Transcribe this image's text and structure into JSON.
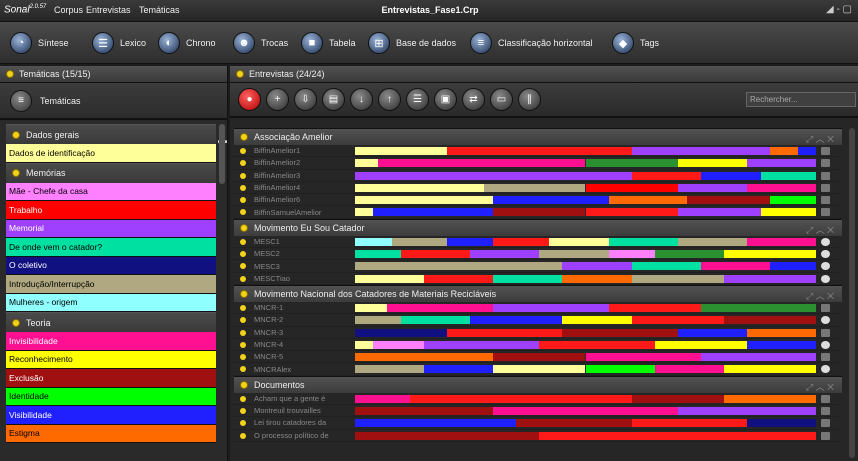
{
  "window": {
    "logo": "Sonal",
    "logo_sup": "2.0.57",
    "menu": [
      "Corpus",
      "Entrevistas",
      "Temáticas"
    ],
    "title": "Entrevistas_Fase1.Crp",
    "controls": "◢ - ▢"
  },
  "toolbar": [
    {
      "label": "Síntese",
      "icon": "synthesis-icon",
      "glyph": "◔"
    },
    {
      "label": "Lexico",
      "icon": "lexicon-icon",
      "glyph": "☰"
    },
    {
      "label": "Chrono",
      "icon": "chrono-icon",
      "glyph": "◐"
    },
    {
      "label": "Trocas",
      "icon": "exchanges-icon",
      "glyph": "☻"
    },
    {
      "label": "Tabela",
      "icon": "table-icon",
      "glyph": "■"
    },
    {
      "label": "Base de dados",
      "icon": "database-icon",
      "glyph": "⊞"
    },
    {
      "label": "Classificação horizontal",
      "icon": "classification-icon",
      "glyph": "≡"
    },
    {
      "label": "Tags",
      "icon": "tags-icon",
      "glyph": "◆"
    }
  ],
  "left_panel": {
    "header": "Temáticas (15/15)",
    "header_ctl": "▬",
    "sub_label": "Temáticas",
    "groups": [
      {
        "name": "Dados gerais",
        "themes": [
          {
            "label": "Dados de identificação",
            "color": "#ffff99",
            "text": "#000000"
          }
        ]
      },
      {
        "name": "Memórias",
        "themes": [
          {
            "label": "Mãe - Chefe da casa",
            "color": "#ff80ff",
            "text": "#000000"
          },
          {
            "label": "Trabalho",
            "color": "#ff0000",
            "text": "#ffffff"
          },
          {
            "label": "Memorial",
            "color": "#a040ff",
            "text": "#ffffff"
          },
          {
            "label": "De onde vem o catador?",
            "color": "#00e0a0",
            "text": "#000000"
          },
          {
            "label": "O coletivo",
            "color": "#101080",
            "text": "#ffffff"
          },
          {
            "label": "Introdução/Interrupção",
            "color": "#b0a880",
            "text": "#000000"
          },
          {
            "label": "Mulheres - origem",
            "color": "#90ffff",
            "text": "#000000"
          }
        ]
      },
      {
        "name": "Teoria",
        "themes": [
          {
            "label": "Invisibilidade",
            "color": "#ff1090",
            "text": "#ffffff"
          },
          {
            "label": "Reconhecimento",
            "color": "#ffff00",
            "text": "#000000"
          },
          {
            "label": "Exclusão",
            "color": "#a01010",
            "text": "#ffffff"
          },
          {
            "label": "Identidade",
            "color": "#00ff00",
            "text": "#000000"
          },
          {
            "label": "Visibilidade",
            "color": "#2020ff",
            "text": "#ffffff"
          },
          {
            "label": "Estigma",
            "color": "#ff6a00",
            "text": "#000000"
          }
        ]
      }
    ]
  },
  "right_panel": {
    "header": "Entrevistas (24/24)",
    "search_placeholder": "Rechercher...",
    "buttons": [
      {
        "icon": "record-icon",
        "glyph": "●"
      },
      {
        "icon": "add-interview-icon",
        "glyph": "+"
      },
      {
        "icon": "import-icon",
        "glyph": "⇩"
      },
      {
        "icon": "document-icon",
        "glyph": "▤"
      },
      {
        "icon": "download-icon",
        "glyph": "↓"
      },
      {
        "icon": "upload-icon",
        "glyph": "↑"
      },
      {
        "icon": "list-icon",
        "glyph": "☰"
      },
      {
        "icon": "image-icon",
        "glyph": "▣"
      },
      {
        "icon": "transfer-icon",
        "glyph": "⇄"
      },
      {
        "icon": "screen-icon",
        "glyph": "▭"
      },
      {
        "icon": "pause-icon",
        "glyph": "∥"
      }
    ],
    "groups": [
      {
        "name": "Associação Amelior",
        "icon_type": "list",
        "rows": [
          {
            "label": "BiffinAmelior1",
            "segs": [
              [
                0,
                0.2,
                "#ffff99"
              ],
              [
                0.2,
                0.6,
                "#ff1a1a"
              ],
              [
                0.6,
                0.9,
                "#a040ff"
              ],
              [
                0.9,
                0.96,
                "#ff6a00"
              ],
              [
                0.96,
                1,
                "#2020ff"
              ]
            ]
          },
          {
            "label": "BiffinAmelior2",
            "segs": [
              [
                0,
                0.05,
                "#ffff99"
              ],
              [
                0.05,
                0.5,
                "#ff1090"
              ],
              [
                0.5,
                0.7,
                "#2a9030"
              ],
              [
                0.7,
                0.85,
                "#ffff00"
              ],
              [
                0.85,
                1,
                "#a040ff"
              ]
            ]
          },
          {
            "label": "BiffinAmelior3",
            "segs": [
              [
                0,
                0.6,
                "#a040ff"
              ],
              [
                0.6,
                0.75,
                "#ff1a1a"
              ],
              [
                0.75,
                0.88,
                "#2020ff"
              ],
              [
                0.88,
                1,
                "#00e0a0"
              ]
            ]
          },
          {
            "label": "BiffinAmelior4",
            "segs": [
              [
                0,
                0.28,
                "#ffff99"
              ],
              [
                0.28,
                0.5,
                "#b0a880"
              ],
              [
                0.5,
                0.7,
                "#ff0000"
              ],
              [
                0.7,
                0.85,
                "#a040ff"
              ],
              [
                0.85,
                1,
                "#ff1090"
              ]
            ]
          },
          {
            "label": "BiffinAmelior6",
            "segs": [
              [
                0,
                0.3,
                "#ffff99"
              ],
              [
                0.3,
                0.55,
                "#2020ff"
              ],
              [
                0.55,
                0.72,
                "#ff6a00"
              ],
              [
                0.72,
                0.9,
                "#a01010"
              ],
              [
                0.9,
                1,
                "#00ff00"
              ]
            ]
          },
          {
            "label": "BiffinSamuelAmelior",
            "segs": [
              [
                0,
                0.04,
                "#ffff99"
              ],
              [
                0.04,
                0.3,
                "#2020ff"
              ],
              [
                0.3,
                0.5,
                "#a01010"
              ],
              [
                0.5,
                0.7,
                "#ff1a1a"
              ],
              [
                0.7,
                0.88,
                "#a040ff"
              ],
              [
                0.88,
                1,
                "#ffff00"
              ]
            ]
          }
        ]
      },
      {
        "name": "Movimento Eu Sou Catador",
        "icon_type": "play",
        "rows": [
          {
            "label": "MESC1",
            "segs": [
              [
                0,
                0.08,
                "#90ffff"
              ],
              [
                0.08,
                0.2,
                "#b0a880"
              ],
              [
                0.2,
                0.3,
                "#2020ff"
              ],
              [
                0.3,
                0.42,
                "#ff1a1a"
              ],
              [
                0.42,
                0.55,
                "#ffff99"
              ],
              [
                0.55,
                0.7,
                "#00e0a0"
              ],
              [
                0.7,
                0.85,
                "#b0a880"
              ],
              [
                0.85,
                1,
                "#ff1090"
              ]
            ]
          },
          {
            "label": "MESC2",
            "segs": [
              [
                0,
                0.1,
                "#00e0a0"
              ],
              [
                0.1,
                0.25,
                "#ff1a1a"
              ],
              [
                0.25,
                0.4,
                "#a040ff"
              ],
              [
                0.4,
                0.55,
                "#b0a880"
              ],
              [
                0.55,
                0.65,
                "#ff80ff"
              ],
              [
                0.65,
                0.8,
                "#2a9030"
              ],
              [
                0.8,
                1,
                "#ffff00"
              ]
            ]
          },
          {
            "label": "MESC3",
            "segs": [
              [
                0,
                0.45,
                "#b0a880"
              ],
              [
                0.45,
                0.6,
                "#a040ff"
              ],
              [
                0.6,
                0.75,
                "#00e0a0"
              ],
              [
                0.75,
                0.9,
                "#ff1090"
              ],
              [
                0.9,
                1,
                "#2020ff"
              ]
            ]
          },
          {
            "label": "MESCTiao",
            "segs": [
              [
                0,
                0.15,
                "#ffff99"
              ],
              [
                0.15,
                0.3,
                "#ff1a1a"
              ],
              [
                0.3,
                0.45,
                "#00e0a0"
              ],
              [
                0.45,
                0.6,
                "#ff6a00"
              ],
              [
                0.6,
                0.8,
                "#b0a880"
              ],
              [
                0.8,
                1,
                "#a040ff"
              ]
            ]
          }
        ]
      },
      {
        "name": "Movimento Nacional dos Catadores de Materiais Recicláveis",
        "icon_type": "mixed",
        "rows": [
          {
            "label": "MNCR-1",
            "segs": [
              [
                0,
                0.07,
                "#ffff99"
              ],
              [
                0.07,
                0.3,
                "#ff1090"
              ],
              [
                0.3,
                0.55,
                "#a040ff"
              ],
              [
                0.55,
                0.75,
                "#ff1a1a"
              ],
              [
                0.75,
                1,
                "#2a9030"
              ]
            ]
          },
          {
            "label": "MNCR-2",
            "segs": [
              [
                0,
                0.1,
                "#b0a880"
              ],
              [
                0.1,
                0.25,
                "#00e0a0"
              ],
              [
                0.25,
                0.45,
                "#2020ff"
              ],
              [
                0.45,
                0.6,
                "#ffff00"
              ],
              [
                0.6,
                0.8,
                "#ff1a1a"
              ],
              [
                0.8,
                1,
                "#a01010"
              ]
            ]
          },
          {
            "label": "MNCR-3",
            "segs": [
              [
                0,
                0.2,
                "#101080"
              ],
              [
                0.2,
                0.45,
                "#ff1a1a"
              ],
              [
                0.45,
                0.7,
                "#a01010"
              ],
              [
                0.7,
                0.85,
                "#2020ff"
              ],
              [
                0.85,
                1,
                "#ff6a00"
              ]
            ]
          },
          {
            "label": "MNCR-4",
            "segs": [
              [
                0,
                0.04,
                "#ffff99"
              ],
              [
                0.04,
                0.15,
                "#ff80ff"
              ],
              [
                0.15,
                0.4,
                "#a040ff"
              ],
              [
                0.4,
                0.65,
                "#ff1a1a"
              ],
              [
                0.65,
                0.85,
                "#ffff00"
              ],
              [
                0.85,
                1,
                "#2020ff"
              ]
            ]
          },
          {
            "label": "MNCR-5",
            "segs": [
              [
                0,
                0.3,
                "#ff6a00"
              ],
              [
                0.3,
                0.5,
                "#a01010"
              ],
              [
                0.5,
                0.75,
                "#ff1090"
              ],
              [
                0.75,
                1,
                "#a040ff"
              ]
            ]
          },
          {
            "label": "MNCRAlex",
            "segs": [
              [
                0,
                0.15,
                "#b0a880"
              ],
              [
                0.15,
                0.3,
                "#2020ff"
              ],
              [
                0.3,
                0.5,
                "#ffff99"
              ],
              [
                0.5,
                0.65,
                "#00ff00"
              ],
              [
                0.65,
                0.8,
                "#ff1090"
              ],
              [
                0.8,
                1,
                "#ffff00"
              ]
            ]
          }
        ]
      },
      {
        "name": "Documentos",
        "icon_type": "list",
        "rows": [
          {
            "label": "Acham que a gente é",
            "segs": [
              [
                0,
                0.12,
                "#ff1090"
              ],
              [
                0.12,
                0.6,
                "#ff1a1a"
              ],
              [
                0.6,
                0.8,
                "#a01010"
              ],
              [
                0.8,
                1,
                "#ff6a00"
              ]
            ]
          },
          {
            "label": "Montreuil trouvailles",
            "segs": [
              [
                0,
                0.3,
                "#a01010"
              ],
              [
                0.3,
                0.7,
                "#ff1090"
              ],
              [
                0.7,
                1,
                "#a040ff"
              ]
            ]
          },
          {
            "label": "Lei tirou catadores da",
            "segs": [
              [
                0,
                0.35,
                "#2020ff"
              ],
              [
                0.35,
                0.6,
                "#a01010"
              ],
              [
                0.6,
                0.85,
                "#ff1a1a"
              ],
              [
                0.85,
                1,
                "#101080"
              ]
            ]
          },
          {
            "label": "O processo político de",
            "segs": [
              [
                0,
                0.4,
                "#a01010"
              ],
              [
                0.4,
                1,
                "#ff1a1a"
              ]
            ]
          }
        ]
      }
    ]
  }
}
